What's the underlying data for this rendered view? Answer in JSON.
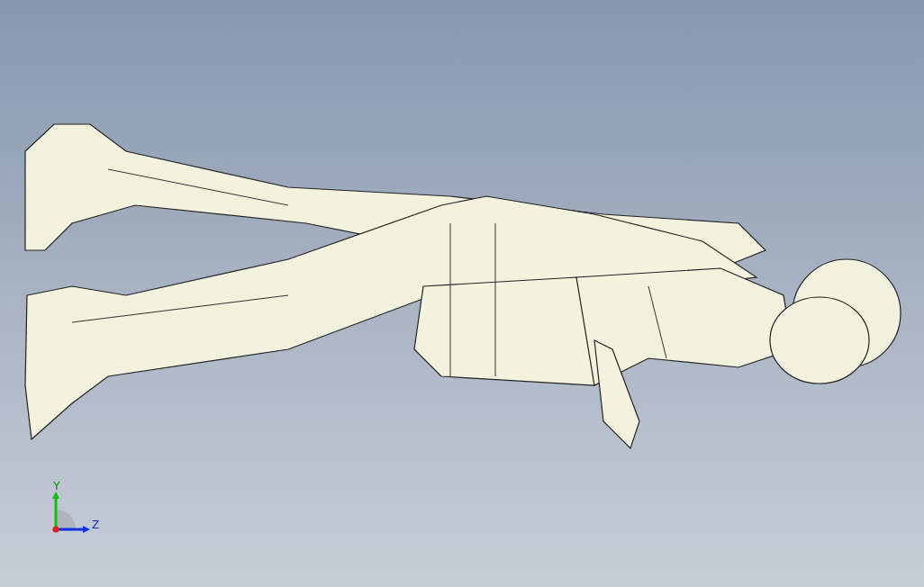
{
  "triad": {
    "axes": [
      {
        "kind": "vertical",
        "label": "Y",
        "color": "#10c010"
      },
      {
        "kind": "horizontal",
        "label": "Z",
        "color": "#1030e0"
      }
    ]
  }
}
